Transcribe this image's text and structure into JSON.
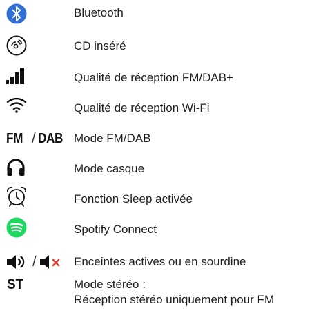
{
  "legend": {
    "rows": [
      {
        "icon": "bluetooth-icon",
        "label": "Bluetooth"
      },
      {
        "icon": "cd-icon",
        "label": "CD inséré"
      },
      {
        "icon": "signal-bars-icon",
        "label": "Qualité de réception FM/DAB+"
      },
      {
        "icon": "wifi-icon",
        "label": "Qualité de réception Wi-Fi"
      },
      {
        "icon_text": {
          "fm": "FM",
          "slash": "/",
          "dab": "DAB"
        },
        "label": "Mode FM/DAB"
      },
      {
        "icon": "headphones-icon",
        "label": "Mode casque"
      },
      {
        "icon": "alarm-clock-icon",
        "label": "Fonction Sleep activée"
      },
      {
        "icon": "spotify-icon",
        "label": "Spotify Connect"
      },
      {
        "icon": "speaker-icons",
        "slash": "/",
        "label": "Enceintes actives ou en sourdine"
      },
      {
        "icon_text": "ST",
        "label_lines": [
          "Mode stéréo :",
          "Réception stéréo uniquement pour FM"
        ]
      }
    ]
  },
  "colors": {
    "bluetooth": "#2f6fd6",
    "spotify": "#1ed760",
    "mute_x": "#e03a2f",
    "ink": "#111111"
  }
}
